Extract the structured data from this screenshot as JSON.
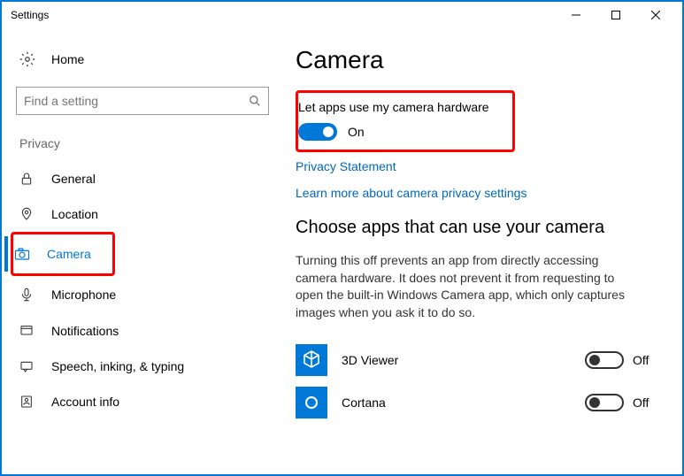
{
  "window": {
    "title": "Settings"
  },
  "sidebar": {
    "home": "Home",
    "search_placeholder": "Find a setting",
    "section": "Privacy",
    "items": [
      {
        "label": "General"
      },
      {
        "label": "Location"
      },
      {
        "label": "Camera"
      },
      {
        "label": "Microphone"
      },
      {
        "label": "Notifications"
      },
      {
        "label": "Speech, inking, & typing"
      },
      {
        "label": "Account info"
      }
    ]
  },
  "main": {
    "title": "Camera",
    "master_toggle": {
      "label": "Let apps use my camera hardware",
      "state": "On"
    },
    "links": {
      "privacy": "Privacy Statement",
      "learn": "Learn more about camera privacy settings"
    },
    "choose_heading": "Choose apps that can use your camera",
    "choose_desc": "Turning this off prevents an app from directly accessing camera hardware. It does not prevent it from requesting to open the built-in Windows Camera app, which only captures images when you ask it to do so.",
    "apps": [
      {
        "name": "3D Viewer",
        "state": "Off"
      },
      {
        "name": "Cortana",
        "state": "Off"
      }
    ]
  }
}
